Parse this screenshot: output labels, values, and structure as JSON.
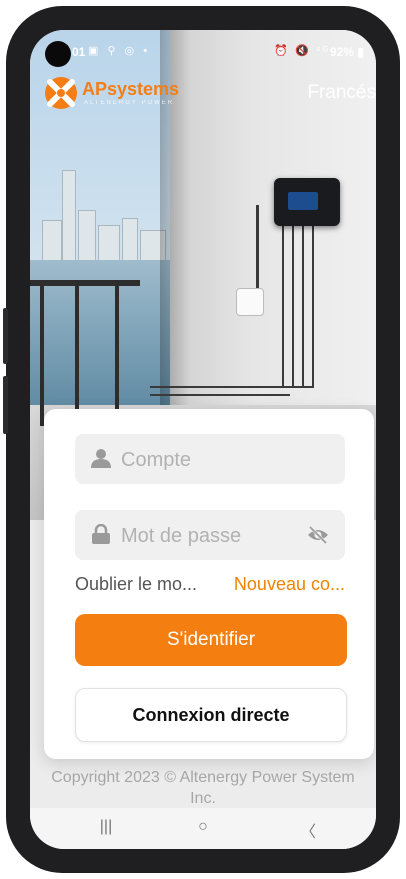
{
  "statusbar": {
    "time_fragment": "01",
    "left_icons": "▣ ⚲ ◎ •",
    "right_icons": "⏰ 🔇 ⁴ᴳ",
    "battery": "92%"
  },
  "logo": {
    "brand_ap": "AP",
    "brand_systems": "systems",
    "tagline": "ALTENERGY POWER"
  },
  "header": {
    "language": "Francés"
  },
  "login": {
    "account_placeholder": "Compte",
    "password_placeholder": "Mot de passe",
    "forgot_label": "Oublier le mo...",
    "new_account_label": "Nouveau co...",
    "login_button": "S'identifier",
    "direct_button": "Connexion directe"
  },
  "footer": {
    "copyright": "Copyright 2023 © Altenergy Power System Inc."
  },
  "nav": {
    "recents": "|||",
    "home": "○",
    "back": "〈"
  },
  "colors": {
    "accent": "#f47e10",
    "link": "#f08300"
  }
}
